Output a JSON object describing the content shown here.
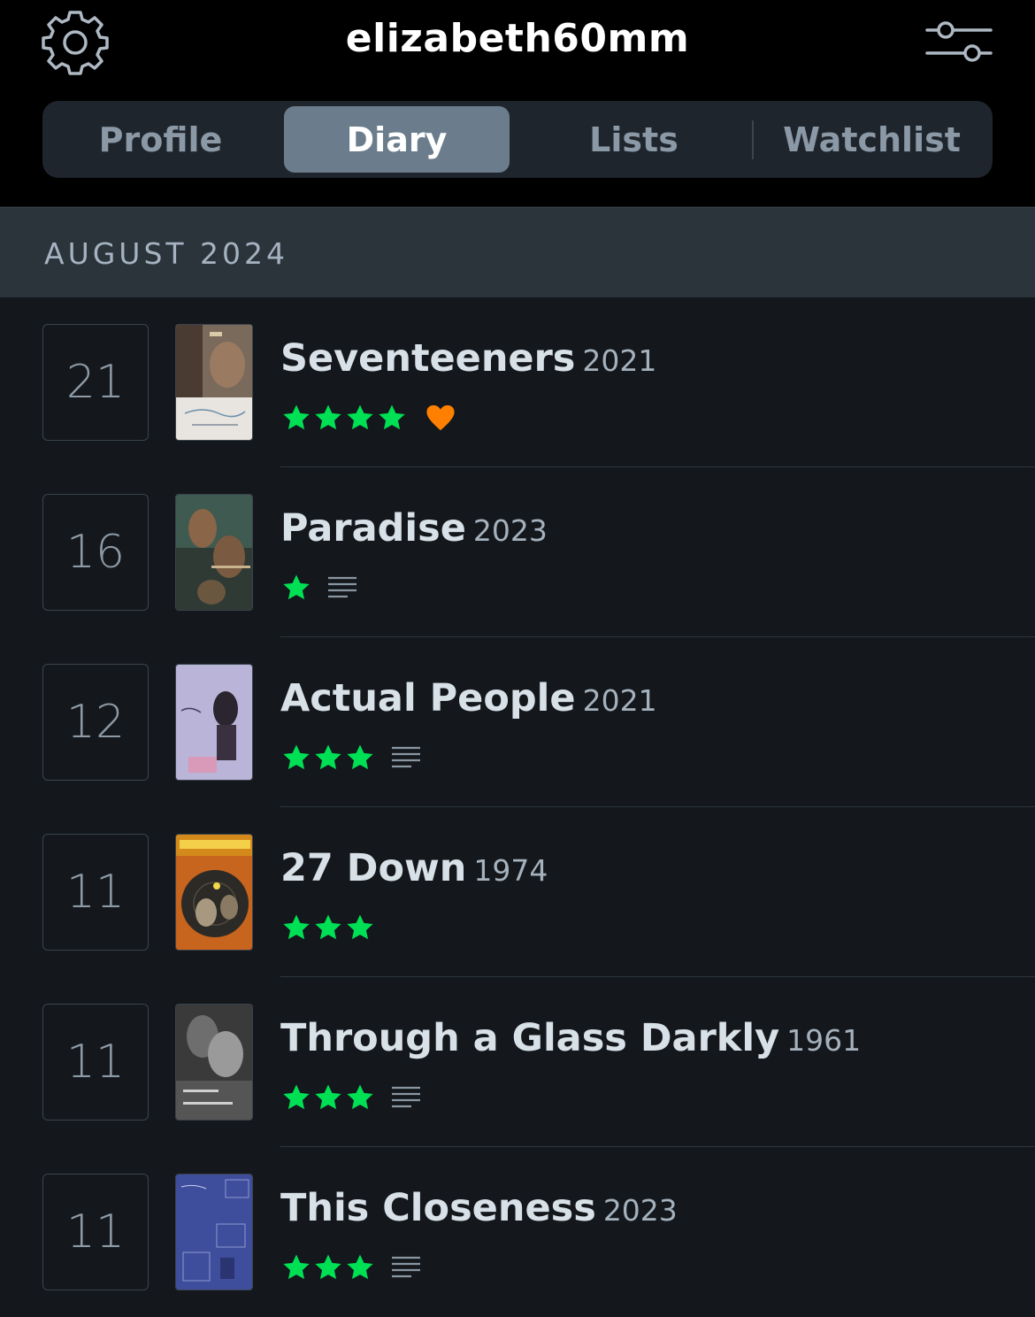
{
  "header": {
    "username": "elizabeth60mm",
    "settings_icon": "gear-icon",
    "filter_icon": "sliders-icon"
  },
  "tabs": [
    {
      "label": "Profile",
      "active": false
    },
    {
      "label": "Diary",
      "active": true
    },
    {
      "label": "Lists",
      "active": false
    },
    {
      "label": "Watchlist",
      "active": false
    }
  ],
  "diary": {
    "month": "AUGUST 2024",
    "entries": [
      {
        "day": "21",
        "title": "Seventeeners",
        "year": "2021",
        "rating": 4,
        "liked": true,
        "review": false
      },
      {
        "day": "16",
        "title": "Paradise",
        "year": "2023",
        "rating": 1,
        "liked": false,
        "review": true
      },
      {
        "day": "12",
        "title": "Actual People",
        "year": "2021",
        "rating": 3,
        "liked": false,
        "review": true
      },
      {
        "day": "11",
        "title": "27 Down",
        "year": "1974",
        "rating": 3,
        "liked": false,
        "review": false
      },
      {
        "day": "11",
        "title": "Through a Glass Darkly",
        "year": "1961",
        "rating": 3,
        "liked": false,
        "review": true
      },
      {
        "day": "11",
        "title": "This Closeness",
        "year": "2023",
        "rating": 3,
        "liked": false,
        "review": true
      }
    ]
  },
  "colors": {
    "star": "#00e054",
    "heart": "#ff8000",
    "active_tab": "#6b7d8c"
  }
}
